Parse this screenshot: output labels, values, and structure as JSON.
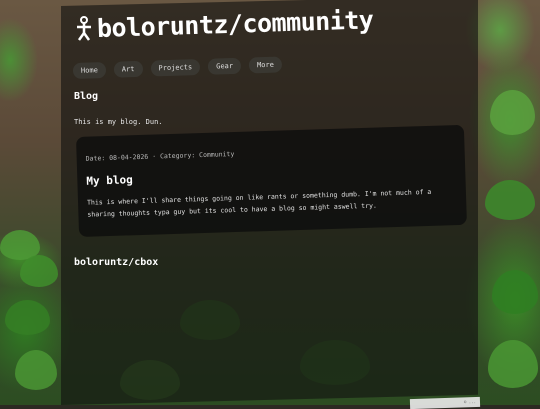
{
  "header": {
    "title": "boloruntz/community",
    "logo_icon": "stick-figure-icon"
  },
  "nav": {
    "items": [
      {
        "label": "Home"
      },
      {
        "label": "Art"
      },
      {
        "label": "Projects"
      },
      {
        "label": "Gear"
      },
      {
        "label": "More"
      }
    ]
  },
  "blog": {
    "heading": "Blog",
    "intro": "This is my blog. Dun.",
    "post": {
      "meta": "Date: 08-04-2026 · Category: Community",
      "title": "My blog",
      "body": "This is where I'll share things going on like rants or something dumb. I'm not much of a sharing thoughts typa guy but its cool to have a blog so might aswell try."
    }
  },
  "cbox": {
    "heading": "boloruntz/cbox"
  },
  "footer": {
    "corner_text": "© ..."
  }
}
